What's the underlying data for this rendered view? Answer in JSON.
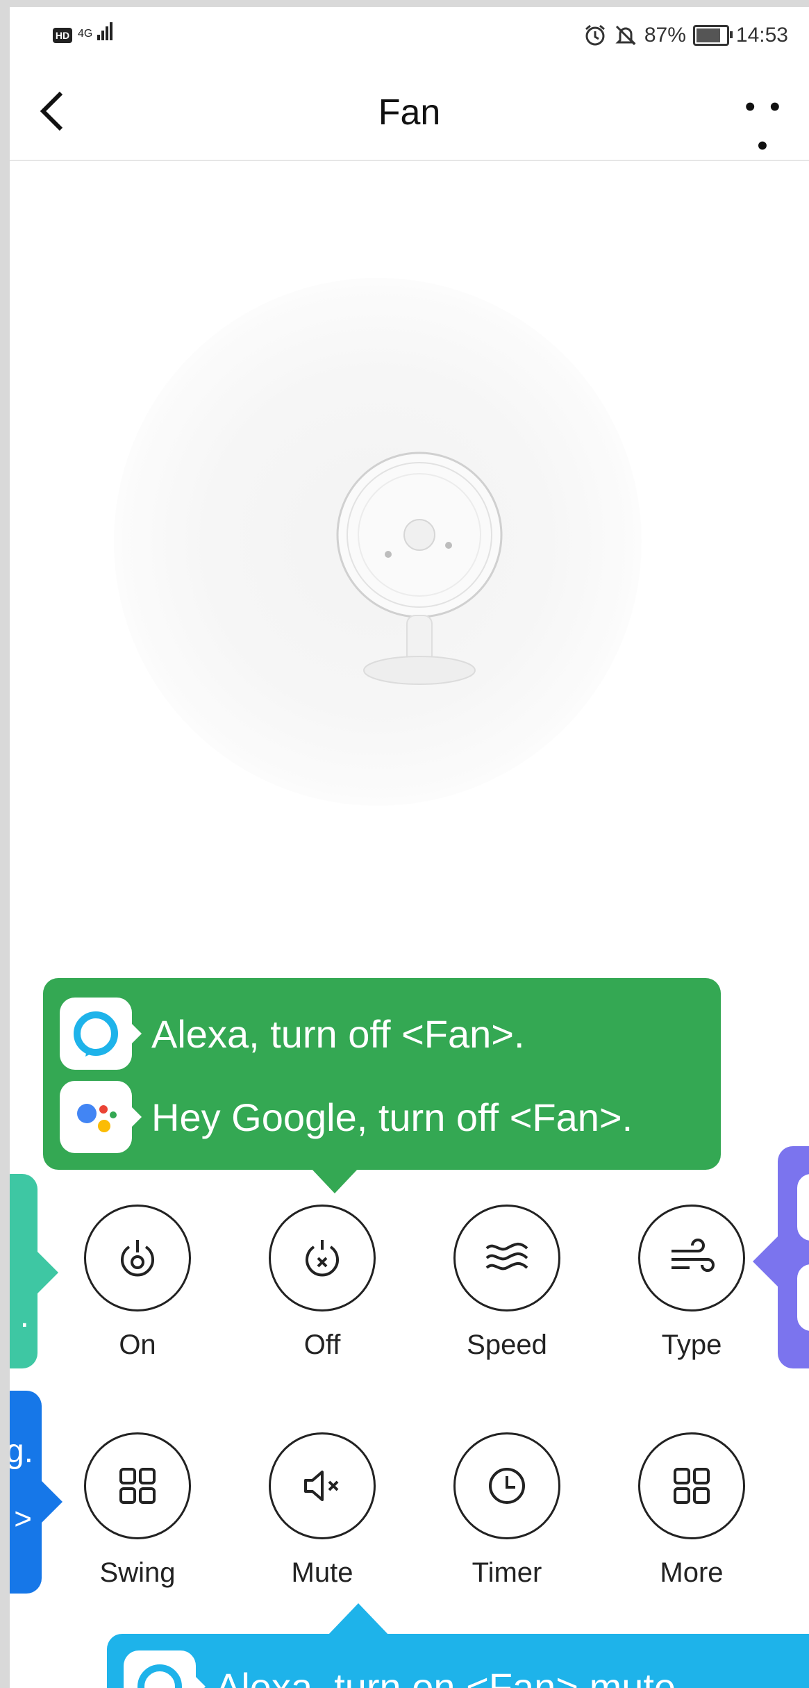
{
  "status_bar": {
    "hd": "HD",
    "network": "4G",
    "battery": "87%",
    "time": "14:53",
    "icons": [
      "alarm-icon",
      "mute-bell-icon",
      "battery-icon"
    ]
  },
  "header": {
    "back_icon": "chevron-left-icon",
    "title": "Fan",
    "more_label": "• • •"
  },
  "controls": [
    {
      "label": "On",
      "icon": "power-on-icon"
    },
    {
      "label": "Off",
      "icon": "power-off-icon"
    },
    {
      "label": "Speed",
      "icon": "waves-icon"
    },
    {
      "label": "Type",
      "icon": "wind-icon"
    },
    {
      "label": "Swing",
      "icon": "grid-icon"
    },
    {
      "label": "Mute",
      "icon": "speaker-mute-icon"
    },
    {
      "label": "Timer",
      "icon": "clock-icon"
    },
    {
      "label": "More",
      "icon": "grid-icon"
    }
  ],
  "voice_tips": {
    "off": {
      "alexa": "Alexa, turn off <Fan>.",
      "google": "Hey Google, turn off <Fan>."
    },
    "on_fragment": ".",
    "swing_fragments": [
      "g.",
      ">"
    ],
    "mute": {
      "alexa": "Alexa, turn on <Fan> mute."
    }
  },
  "colors": {
    "green": "#34a853",
    "teal": "#3ec7a3",
    "blue": "#1677e8",
    "purple": "#7b74ee",
    "cyan": "#1eb3ea",
    "alexa": "#1eb3ea"
  }
}
